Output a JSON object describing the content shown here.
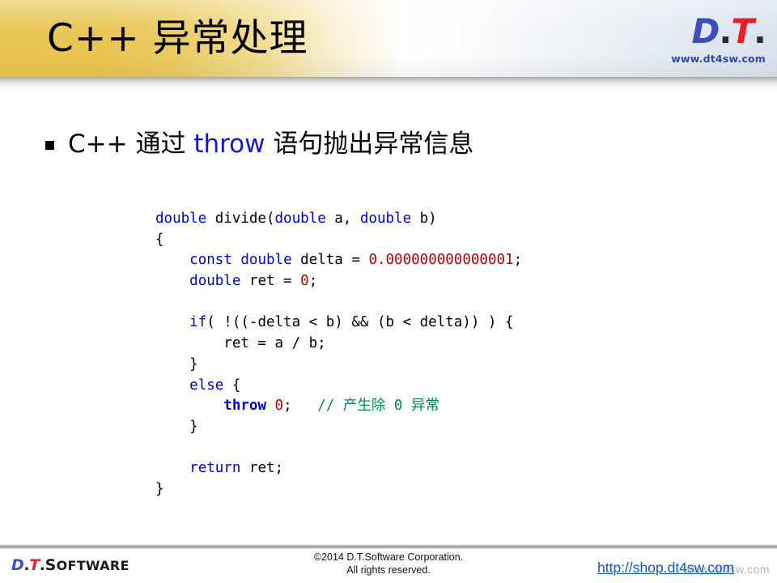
{
  "colors": {
    "header_gold": "#E9C44F",
    "header_blue_gray": "#D9E2EC",
    "logo_blue": "#3B4FBE",
    "logo_red": "#EE1C25",
    "keyword_blue": "#0000CC",
    "number_red": "#B00000",
    "comment_green": "#008B45",
    "link_blue": "#1155CC"
  },
  "header": {
    "title": "C++ 异常处理",
    "logo": {
      "d": "D",
      "dot1": ".",
      "t": "T",
      "dot2": ".",
      "url": "www.dt4sw.com"
    }
  },
  "body": {
    "bullet": {
      "marker": "square-bullet",
      "part1": "C++ 通过 ",
      "keyword": "throw",
      "part2": " 语句抛出异常信息"
    },
    "code": {
      "language": "cpp",
      "lines": [
        [
          {
            "t": "double",
            "c": "kw"
          },
          {
            "t": " divide(",
            "c": "plain"
          },
          {
            "t": "double",
            "c": "kw"
          },
          {
            "t": " a, ",
            "c": "plain"
          },
          {
            "t": "double",
            "c": "kw"
          },
          {
            "t": " b)",
            "c": "plain"
          }
        ],
        [
          {
            "t": "{",
            "c": "plain"
          }
        ],
        [
          {
            "t": "    ",
            "c": "plain"
          },
          {
            "t": "const",
            "c": "kw"
          },
          {
            "t": " ",
            "c": "plain"
          },
          {
            "t": "double",
            "c": "kw"
          },
          {
            "t": " delta = ",
            "c": "plain"
          },
          {
            "t": "0.000000000000001",
            "c": "num"
          },
          {
            "t": ";",
            "c": "plain"
          }
        ],
        [
          {
            "t": "    ",
            "c": "plain"
          },
          {
            "t": "double",
            "c": "kw"
          },
          {
            "t": " ret = ",
            "c": "plain"
          },
          {
            "t": "0",
            "c": "num"
          },
          {
            "t": ";",
            "c": "plain"
          }
        ],
        [],
        [
          {
            "t": "    ",
            "c": "plain"
          },
          {
            "t": "if",
            "c": "kw"
          },
          {
            "t": "( !((-delta < b) && (b < delta)) ) {",
            "c": "plain"
          }
        ],
        [
          {
            "t": "        ret = a / b;",
            "c": "plain"
          }
        ],
        [
          {
            "t": "    }",
            "c": "plain"
          }
        ],
        [
          {
            "t": "    ",
            "c": "plain"
          },
          {
            "t": "else",
            "c": "kw"
          },
          {
            "t": " {",
            "c": "plain"
          }
        ],
        [
          {
            "t": "        ",
            "c": "plain"
          },
          {
            "t": "throw",
            "c": "thr"
          },
          {
            "t": " ",
            "c": "plain"
          },
          {
            "t": "0",
            "c": "num"
          },
          {
            "t": ";   ",
            "c": "plain"
          },
          {
            "t": "// 产生除 0 异常",
            "c": "cmt"
          }
        ],
        [
          {
            "t": "    }",
            "c": "plain"
          }
        ],
        [],
        [
          {
            "t": "    ",
            "c": "plain"
          },
          {
            "t": "return",
            "c": "kw"
          },
          {
            "t": " ret;",
            "c": "plain"
          }
        ],
        [
          {
            "t": "}",
            "c": "plain"
          }
        ]
      ]
    }
  },
  "footer": {
    "logo": {
      "d": "D",
      "dot1": ".",
      "t": "T",
      "dot2": ".",
      "software_cap": "S",
      "software_rest": "OFTWARE"
    },
    "copyright_line1": "©2014 D.T.Software Corporation.",
    "copyright_line2": "All rights reserved.",
    "shop_url": "http://shop.dt4sw.com",
    "watermark": "www.dt4sw.com"
  }
}
